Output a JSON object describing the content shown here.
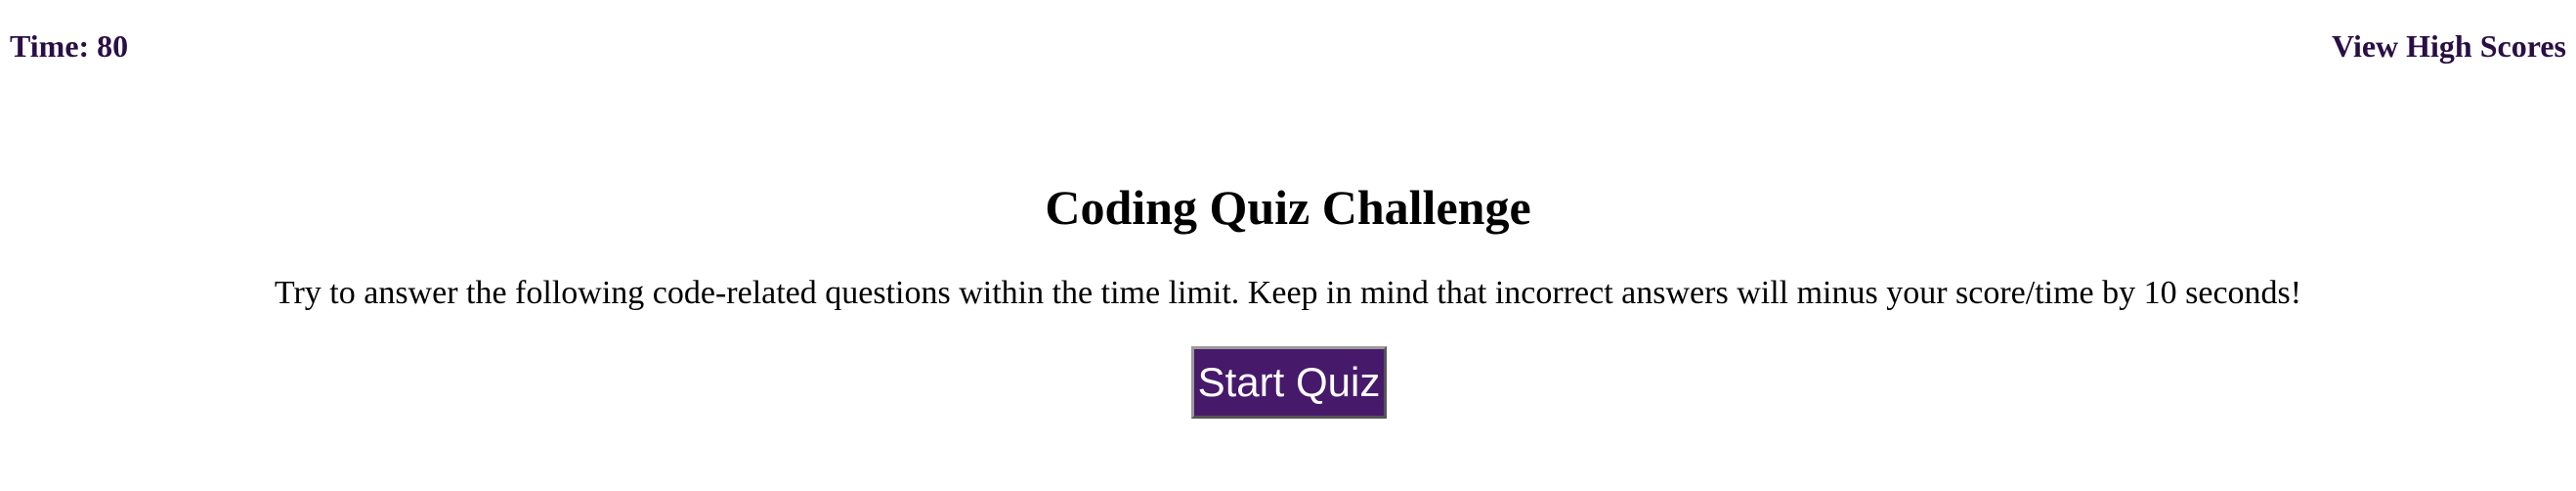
{
  "header": {
    "timer_label": "Time: 80",
    "high_scores_link": "View High Scores"
  },
  "main": {
    "title": "Coding Quiz Challenge",
    "intro": "Try to answer the following code-related questions within the time limit. Keep in mind that incorrect answers will minus your score/time by 10 seconds!",
    "start_button": "Start Quiz"
  },
  "colors": {
    "accent": "#46196b",
    "header_text": "#2a0f45",
    "body_text": "#000000",
    "background": "#ffffff",
    "button_text": "#ffffff"
  }
}
